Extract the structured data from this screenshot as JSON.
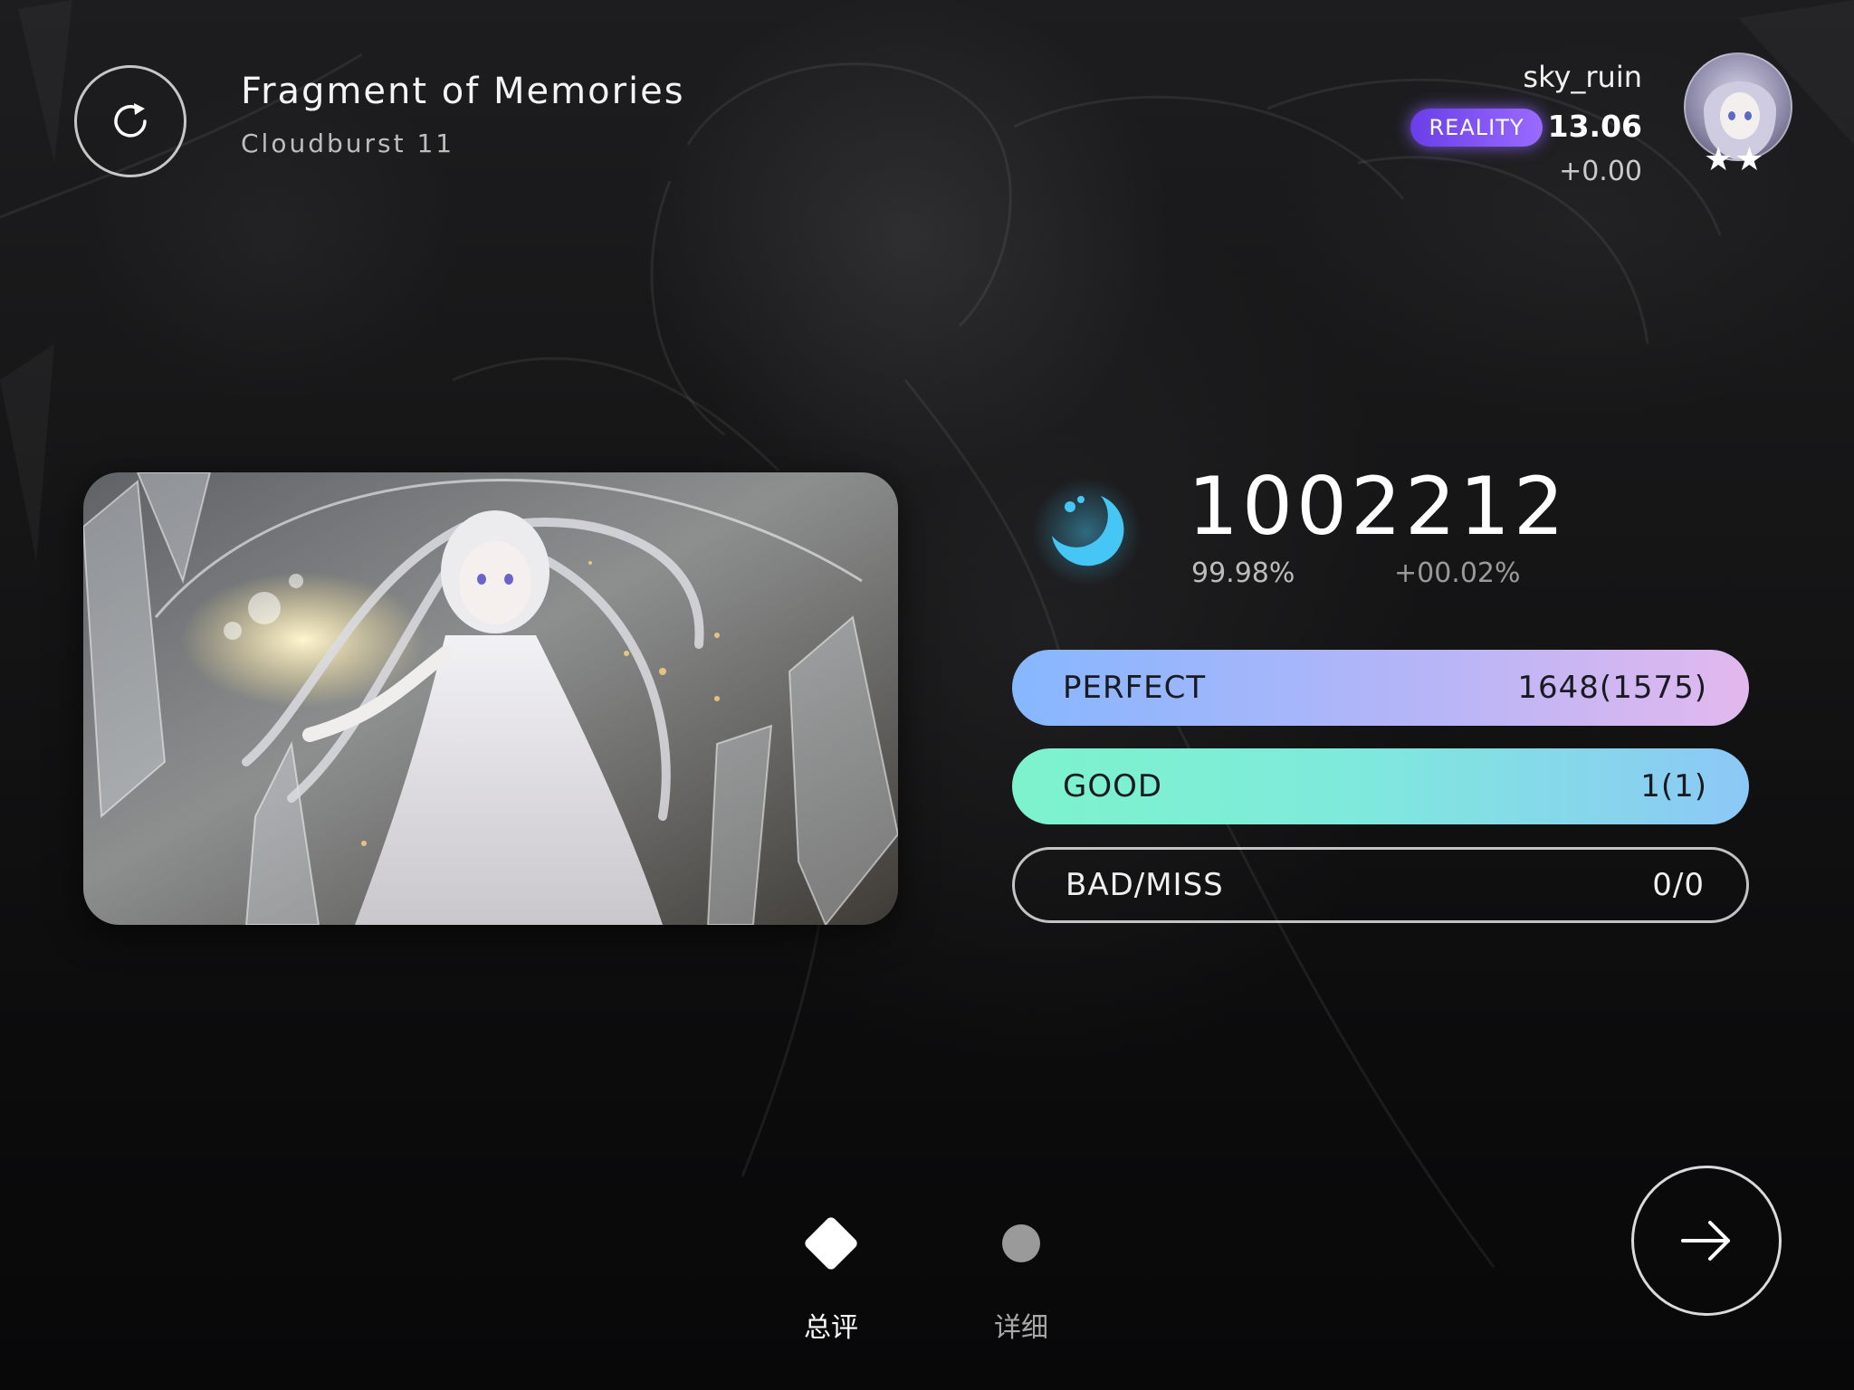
{
  "song": {
    "title": "Fragment of Memories",
    "difficulty": "Cloudburst 11"
  },
  "player": {
    "name": "sky_ruin",
    "rank_badge": "REALITY",
    "rks": "13.06",
    "rks_delta": "+0.00",
    "stars": "★★"
  },
  "result": {
    "score": "1002212",
    "accuracy": "99.98%",
    "accuracy_delta": "+00.02%",
    "grade_icon": "crescent-moon-icon"
  },
  "judgements": {
    "perfect": {
      "label": "PERFECT",
      "value": "1648(1575)"
    },
    "good": {
      "label": "GOOD",
      "value": "1(1)"
    },
    "badmiss": {
      "label": "BAD/MISS",
      "value": "0/0"
    }
  },
  "tabs": [
    {
      "label": "总评",
      "icon": "diamond-icon",
      "active": true
    },
    {
      "label": "详细",
      "icon": "dot-icon",
      "active": false
    }
  ],
  "colors": {
    "perfect_gradient": [
      "#86b7ff",
      "#e2b8ee"
    ],
    "good_gradient": [
      "#7df3cc",
      "#8cc8f6"
    ],
    "rank_badge": "#7a4cf0",
    "grade_icon": "#46c6f5"
  }
}
